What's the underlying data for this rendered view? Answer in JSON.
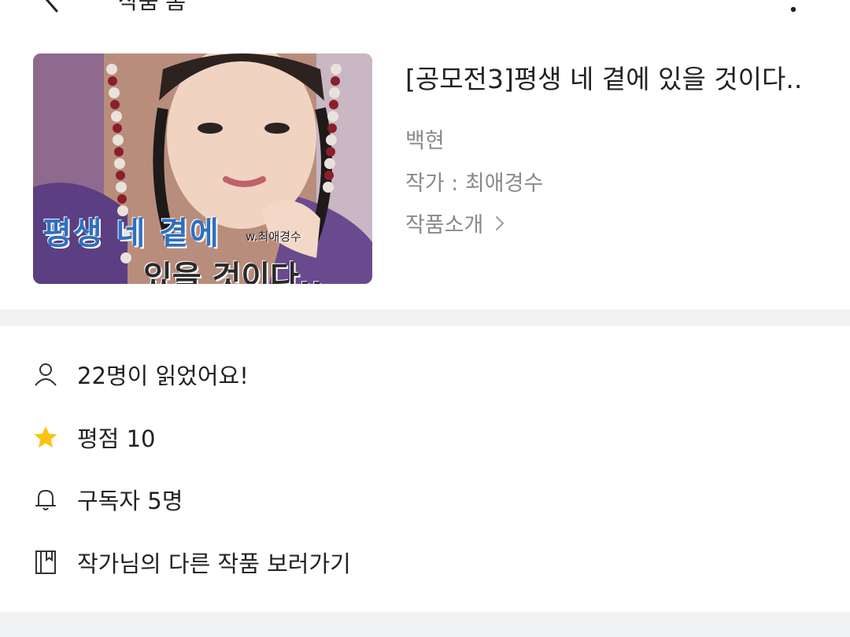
{
  "topbar": {
    "title": "작품 홈",
    "back_icon": "chevron-left-icon",
    "more_icon": "more-vertical-icon"
  },
  "work": {
    "thumbnail": {
      "caption_line1": "평생 네 곁에",
      "caption_line2": "있을 것이다..",
      "signature": "w.최애경수"
    },
    "title": "[공모전3]평생 네 곁에 있을 것이다..",
    "genre": "백현",
    "author": "작가 : 최애경수",
    "intro_label": "작품소개"
  },
  "info": {
    "readers": "22명이 읽었어요!",
    "rating": "평점 10",
    "subscribers": "구독자 5명",
    "other_works": "작가님의 다른 작품 보러가기"
  },
  "colors": {
    "star": "#f9c413",
    "divider": "#f1f2f4",
    "meta_text": "#8a8a8a"
  }
}
